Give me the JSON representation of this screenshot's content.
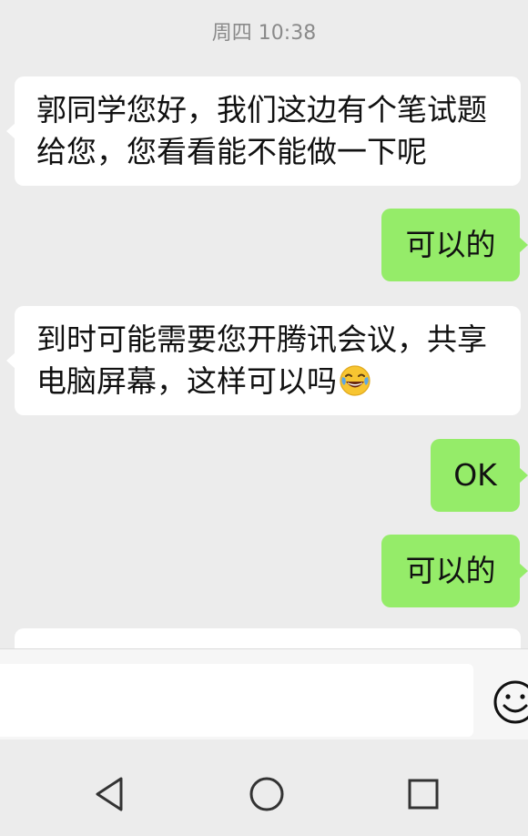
{
  "chat": {
    "timestamp": "周四 10:38",
    "messages": [
      {
        "side": "in",
        "line1": "郭同学您好，我们这边有个笔试题",
        "line2": "给您，您看看能不能做一下呢"
      },
      {
        "side": "out",
        "text": "可以的"
      },
      {
        "side": "in",
        "line1": "到时可能需要您开腾讯会议，共享",
        "line2": "电脑屏幕，这样可以吗",
        "emoji": "face-with-tears-of-joy"
      },
      {
        "side": "out",
        "text": "OK"
      },
      {
        "side": "out",
        "text": "可以的"
      }
    ]
  },
  "input": {
    "value": "",
    "emoji_button_icon": "smiley-icon"
  },
  "navbar": {
    "back_icon": "triangle-back-icon",
    "home_icon": "circle-home-icon",
    "recents_icon": "square-recents-icon"
  },
  "colors": {
    "background": "#ececec",
    "incoming_bubble": "#ffffff",
    "outgoing_bubble": "#95ec69",
    "timestamp_text": "#8a8a8a"
  }
}
